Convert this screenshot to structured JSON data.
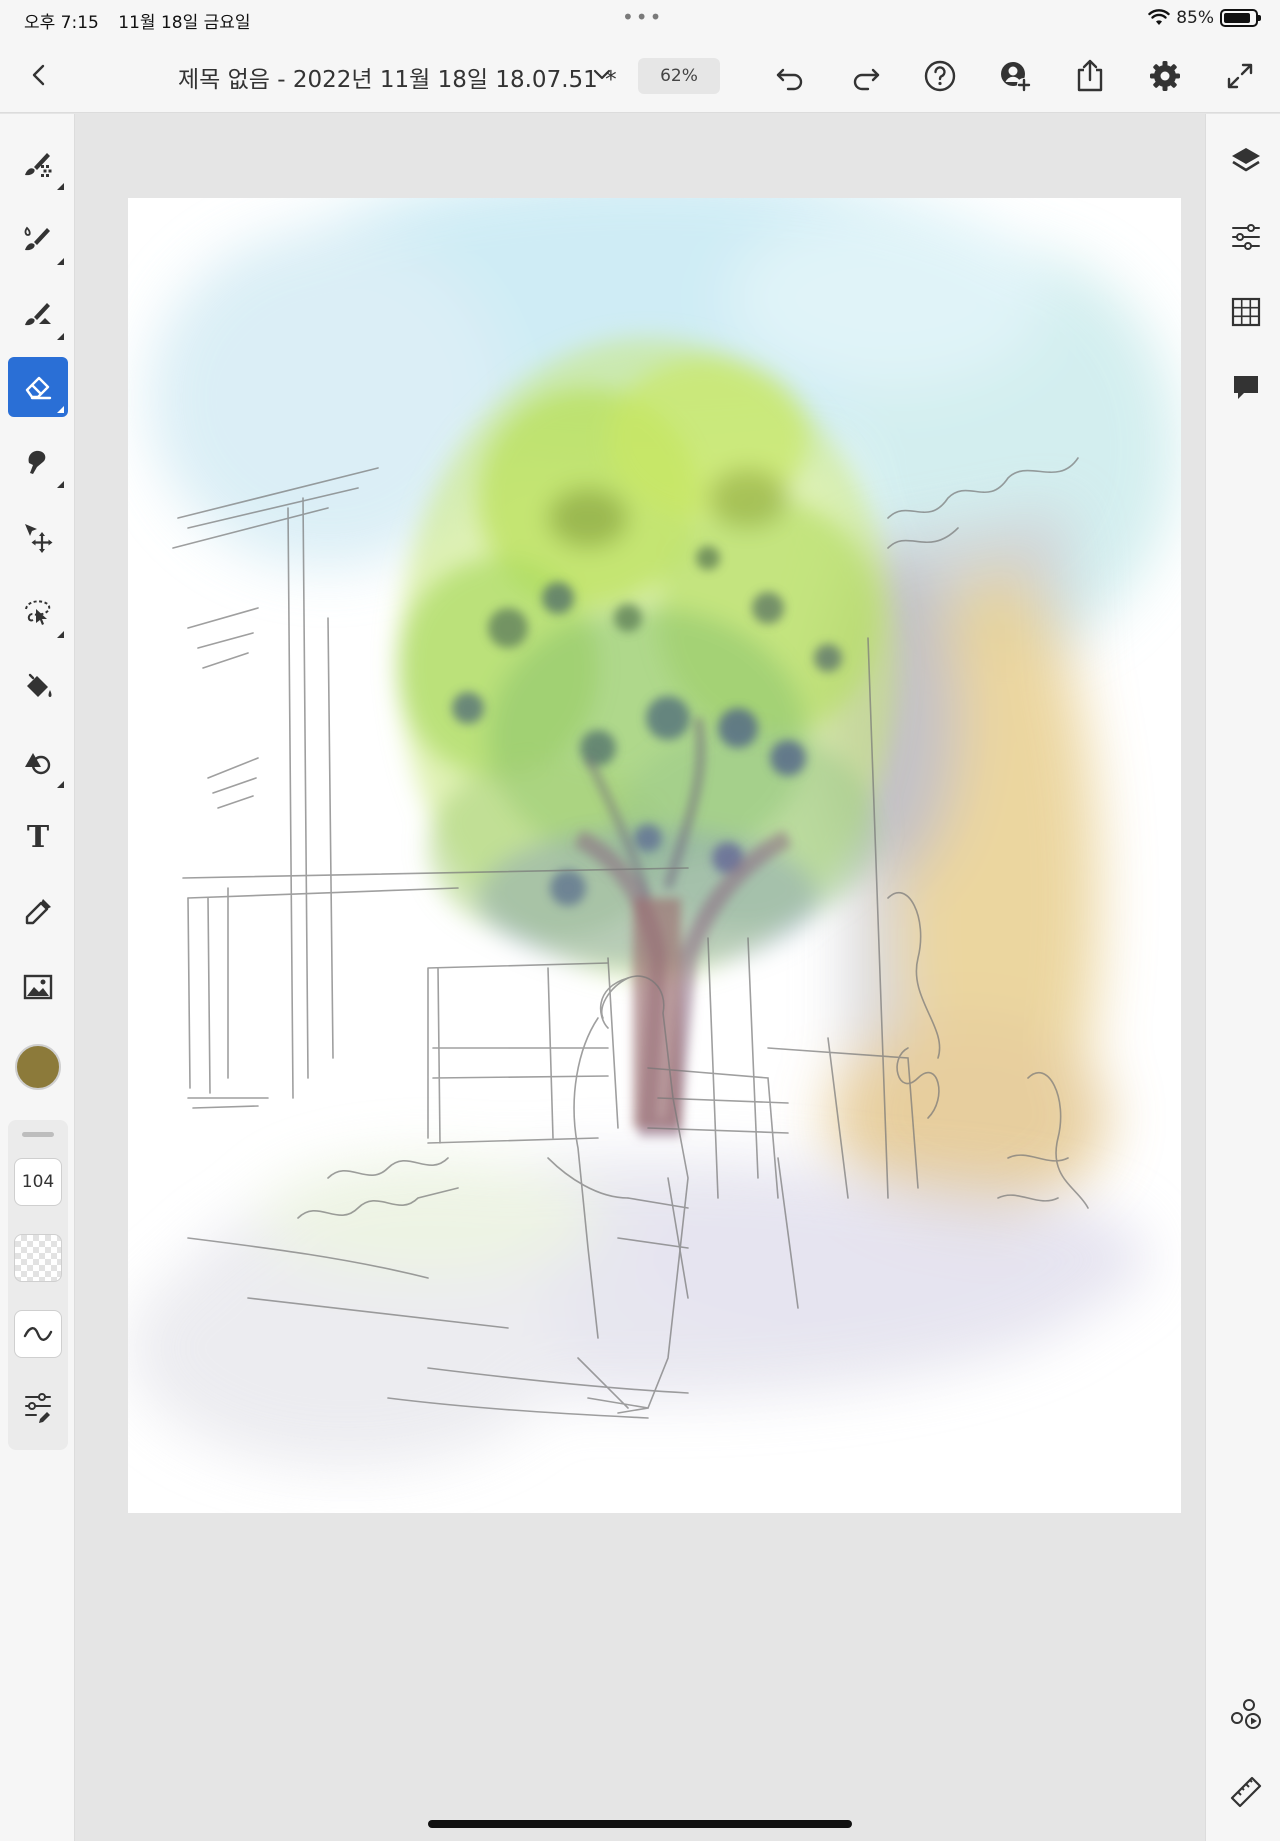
{
  "status_bar": {
    "time": "오후 7:15",
    "date": "11월 18일 금요일",
    "battery": "85%",
    "battery_level": 0.85
  },
  "toolbar": {
    "title": "제목 없음 - 2022년 11월 18일 18.07.51 *",
    "zoom": "62%",
    "icons": [
      "back-icon",
      "chevron-down-icon",
      "undo-icon",
      "redo-icon",
      "help-icon",
      "invite-icon",
      "share-icon",
      "settings-icon",
      "fullscreen-icon"
    ]
  },
  "tools": {
    "items": [
      "pixel-brush",
      "live-brush",
      "vector-brush",
      "eraser",
      "smudge",
      "transform",
      "selection",
      "fill",
      "shape",
      "text",
      "eyedropper",
      "image"
    ],
    "active": "eraser",
    "text_tool_glyph": "T",
    "current_color": "#8c7a3a"
  },
  "brush_settings": {
    "size": "104"
  },
  "right_panel": {
    "icons": [
      "layers-icon",
      "adjustments-icon",
      "grid-icon",
      "comments-icon",
      "livestream-icon",
      "ruler-icon"
    ]
  },
  "colors": {
    "accent": "#2a6fd6",
    "panel_bg": "#f6f6f6",
    "workspace_bg": "#e5e5e5"
  }
}
